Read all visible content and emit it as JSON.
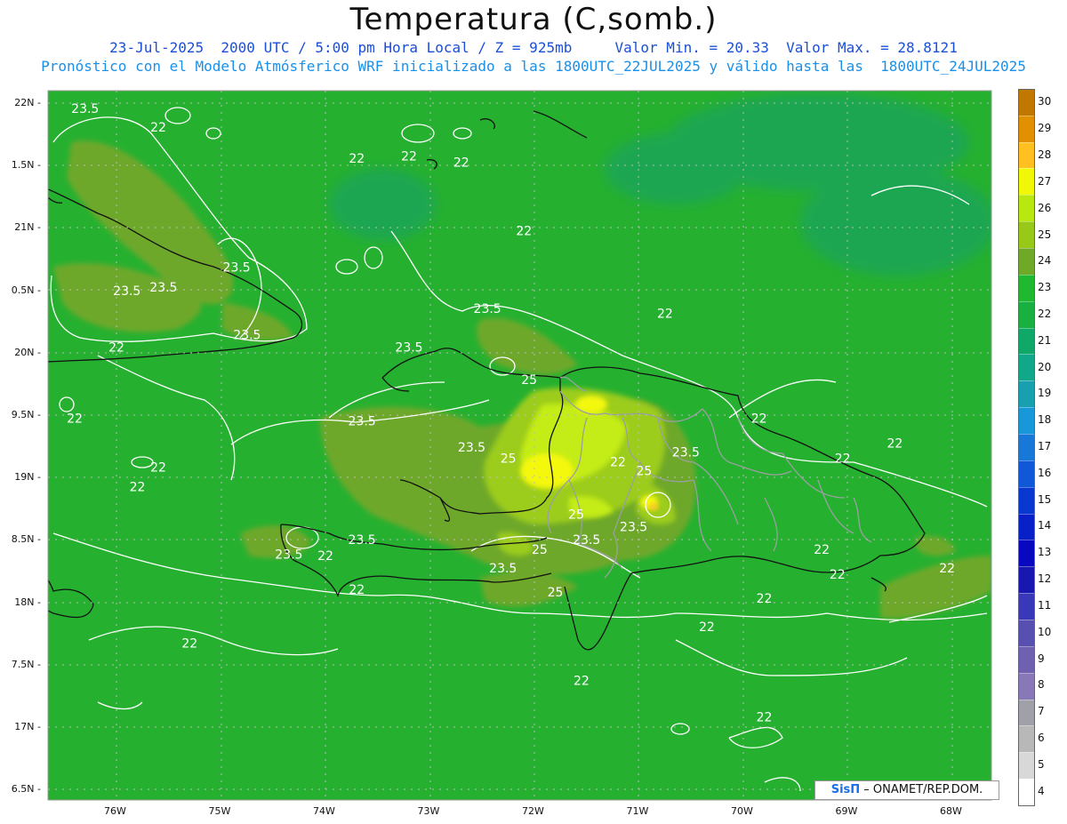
{
  "header": {
    "title": "Temperatura (C,somb.)",
    "line1": "23-Jul-2025  2000 UTC / 5:00 pm Hora Local / Z = 925mb     Valor Min. = 20.33  Valor Max. = 28.8121",
    "line2": "Pronóstico con el Modelo Atmósferico WRF inicializado a las 1800UTC_22JUL2025 y válido hasta las  1800UTC_24JUL2025"
  },
  "map": {
    "lat_labels": [
      "22N",
      "1.5N",
      "21N",
      "0.5N",
      "20N",
      "9.5N",
      "19N",
      "8.5N",
      "18N",
      "7.5N",
      "17N",
      "6.5N"
    ],
    "lon_labels": [
      "76W",
      "75W",
      "74W",
      "73W",
      "72W",
      "71W",
      "70W",
      "69W",
      "68W"
    ],
    "contour_labels": [
      {
        "text": "23.5",
        "lon": -76.3,
        "lat": 21.95
      },
      {
        "text": "22",
        "lon": -75.6,
        "lat": 21.8
      },
      {
        "text": "22",
        "lon": -73.7,
        "lat": 21.55
      },
      {
        "text": "22",
        "lon": -73.2,
        "lat": 21.57
      },
      {
        "text": "22",
        "lon": -72.7,
        "lat": 21.52
      },
      {
        "text": "22",
        "lon": -72.1,
        "lat": 20.97
      },
      {
        "text": "23.5",
        "lon": -74.85,
        "lat": 20.68
      },
      {
        "text": "23.5",
        "lon": -75.9,
        "lat": 20.49
      },
      {
        "text": "23.5",
        "lon": -75.55,
        "lat": 20.52
      },
      {
        "text": "23.5",
        "lon": -74.75,
        "lat": 20.14
      },
      {
        "text": "23.5",
        "lon": -72.45,
        "lat": 20.35
      },
      {
        "text": "22",
        "lon": -70.75,
        "lat": 20.31
      },
      {
        "text": "22",
        "lon": -76.0,
        "lat": 20.04
      },
      {
        "text": "23.5",
        "lon": -73.2,
        "lat": 20.04
      },
      {
        "text": "25",
        "lon": -72.05,
        "lat": 19.78
      },
      {
        "text": "22",
        "lon": -76.4,
        "lat": 19.47
      },
      {
        "text": "22",
        "lon": -69.85,
        "lat": 19.47
      },
      {
        "text": "23.5",
        "lon": -73.65,
        "lat": 19.45
      },
      {
        "text": "23.5",
        "lon": -72.6,
        "lat": 19.24
      },
      {
        "text": "25",
        "lon": -72.25,
        "lat": 19.15
      },
      {
        "text": "22",
        "lon": -71.2,
        "lat": 19.12
      },
      {
        "text": "25",
        "lon": -70.95,
        "lat": 19.05
      },
      {
        "text": "23.5",
        "lon": -70.55,
        "lat": 19.2
      },
      {
        "text": "22",
        "lon": -68.55,
        "lat": 19.27
      },
      {
        "text": "22",
        "lon": -69.05,
        "lat": 19.15
      },
      {
        "text": "22",
        "lon": -75.6,
        "lat": 19.08
      },
      {
        "text": "22",
        "lon": -75.8,
        "lat": 18.92
      },
      {
        "text": "25",
        "lon": -71.6,
        "lat": 18.7
      },
      {
        "text": "23.5",
        "lon": -73.65,
        "lat": 18.5
      },
      {
        "text": "23.5",
        "lon": -71.5,
        "lat": 18.5
      },
      {
        "text": "23.5",
        "lon": -71.05,
        "lat": 18.6
      },
      {
        "text": "25",
        "lon": -71.95,
        "lat": 18.42
      },
      {
        "text": "23.5",
        "lon": -72.3,
        "lat": 18.27
      },
      {
        "text": "23.5",
        "lon": -74.35,
        "lat": 18.38
      },
      {
        "text": "22",
        "lon": -74.0,
        "lat": 18.37
      },
      {
        "text": "22",
        "lon": -69.25,
        "lat": 18.42
      },
      {
        "text": "22",
        "lon": -69.1,
        "lat": 18.22
      },
      {
        "text": "22",
        "lon": -68.05,
        "lat": 18.27
      },
      {
        "text": "25",
        "lon": -71.8,
        "lat": 18.08
      },
      {
        "text": "22",
        "lon": -69.8,
        "lat": 18.03
      },
      {
        "text": "22",
        "lon": -73.7,
        "lat": 18.1
      },
      {
        "text": "22",
        "lon": -70.35,
        "lat": 17.8
      },
      {
        "text": "22",
        "lon": -75.3,
        "lat": 17.67
      },
      {
        "text": "22",
        "lon": -71.55,
        "lat": 17.37
      },
      {
        "text": "22",
        "lon": -69.8,
        "lat": 17.08
      }
    ]
  },
  "legend": {
    "levels": [
      "4",
      "5",
      "6",
      "7",
      "8",
      "9",
      "10",
      "11",
      "12",
      "13",
      "14",
      "15",
      "16",
      "17",
      "18",
      "19",
      "20",
      "21",
      "22",
      "23",
      "24",
      "25",
      "26",
      "27",
      "28",
      "29",
      "30"
    ],
    "colors": [
      "#ffffff",
      "#d8d8d8",
      "#b8b8b8",
      "#a0a0a8",
      "#8878b8",
      "#7060b0",
      "#5850b0",
      "#3838b8",
      "#1818b0",
      "#0808c0",
      "#0820c8",
      "#0838d0",
      "#1058d8",
      "#1878d8",
      "#1898d8",
      "#18a0b0",
      "#10a888",
      "#10a868",
      "#18b040",
      "#20b830",
      "#70a828",
      "#98c818",
      "#b8e810",
      "#f0f808",
      "#ffc020",
      "#e09000",
      "#c07800"
    ]
  },
  "credit": {
    "brand": "SisΠ",
    "text": " – ONAMET/REP.DOM."
  }
}
